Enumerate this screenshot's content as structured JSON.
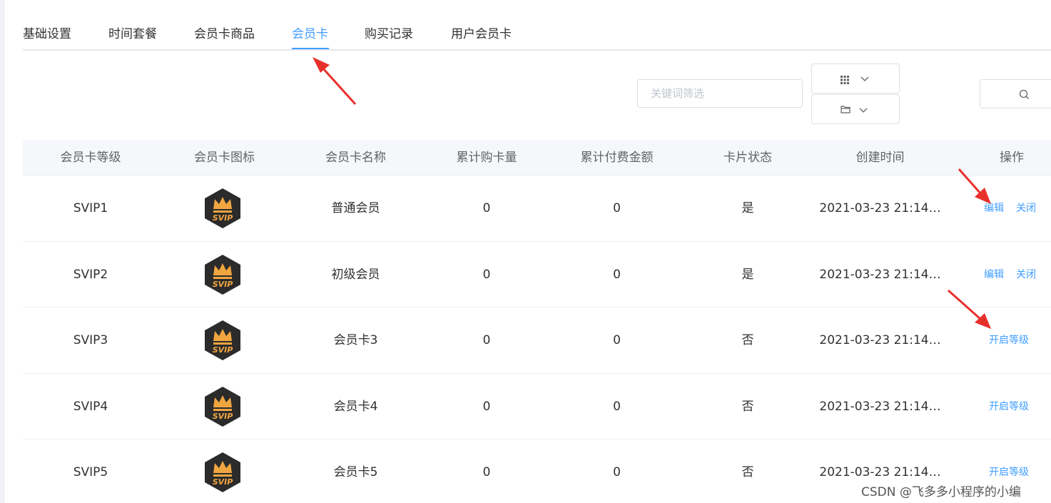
{
  "tabs": [
    {
      "label": "基础设置"
    },
    {
      "label": "时间套餐"
    },
    {
      "label": "会员卡商品"
    },
    {
      "label": "会员卡"
    },
    {
      "label": "购买记录"
    },
    {
      "label": "用户会员卡"
    }
  ],
  "active_tab_index": 3,
  "toolbar": {
    "search_placeholder": "关键词筛选",
    "search_value": ""
  },
  "table": {
    "columns": [
      "会员卡等级",
      "会员卡图标",
      "会员卡名称",
      "累计购卡量",
      "累计付费金额",
      "卡片状态",
      "创建时间",
      "操作"
    ],
    "badge_text": "SVIP",
    "rows": [
      {
        "level": "SVIP1",
        "name": "普通会员",
        "count": "0",
        "amount": "0",
        "status": "是",
        "created": "2021-03-23 21:14…",
        "actions": [
          "编辑",
          "关闭"
        ]
      },
      {
        "level": "SVIP2",
        "name": "初级会员",
        "count": "0",
        "amount": "0",
        "status": "是",
        "created": "2021-03-23 21:14…",
        "actions": [
          "编辑",
          "关闭"
        ]
      },
      {
        "level": "SVIP3",
        "name": "会员卡3",
        "count": "0",
        "amount": "0",
        "status": "否",
        "created": "2021-03-23 21:14…",
        "actions": [
          "开启等级"
        ]
      },
      {
        "level": "SVIP4",
        "name": "会员卡4",
        "count": "0",
        "amount": "0",
        "status": "否",
        "created": "2021-03-23 21:14…",
        "actions": [
          "开启等级"
        ]
      },
      {
        "level": "SVIP5",
        "name": "会员卡5",
        "count": "0",
        "amount": "0",
        "status": "否",
        "created": "2021-03-23 21:14…",
        "actions": [
          "开启等级"
        ]
      }
    ]
  },
  "watermark": "CSDN @飞多多小程序的小编",
  "colors": {
    "accent": "#409eff",
    "annotation": "#e8302b",
    "badge_dark": "#2b2b2b",
    "badge_gold": "#f0a640"
  },
  "icons": [
    "grid-icon",
    "chevron-down-icon",
    "folder-icon",
    "search-icon",
    "svip-crown-badge",
    "annotation-arrow"
  ]
}
